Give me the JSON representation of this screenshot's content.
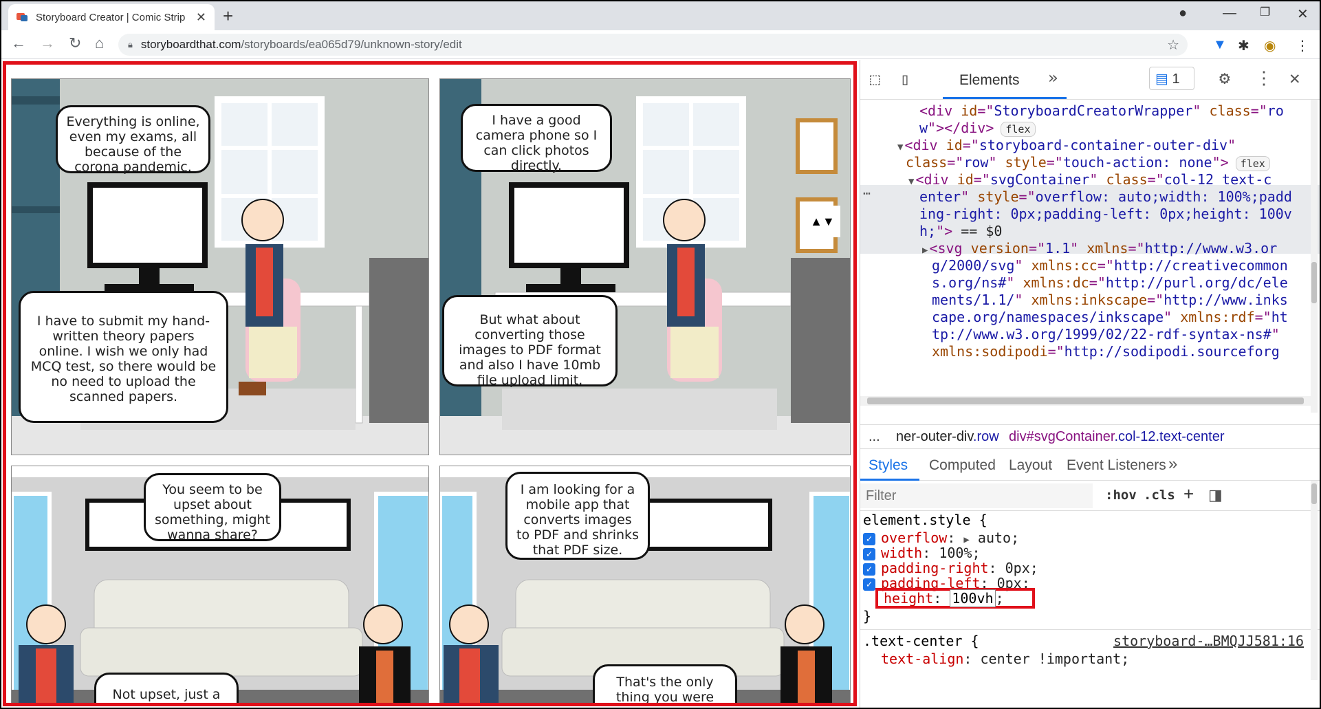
{
  "browser": {
    "tab_title": "Storyboard Creator | Comic Strip",
    "new_tab_label": "+",
    "url_host": "storyboardthat.com",
    "url_path": "/storyboards/ea065d79/unknown-story/edit"
  },
  "comic": {
    "panel1": {
      "bubble_top": "Everything is online, even my exams, all because of the corona pandemic.",
      "bubble_bottom": "I have to submit my hand-written theory papers online. I wish we only had MCQ test, so there would be no need to upload the scanned papers."
    },
    "panel2": {
      "bubble_top": "I have a good camera phone so I can click photos directly.",
      "bubble_bottom": "But what about converting those images to PDF format and also I have 10mb file upload limit.",
      "scroll_arrows": "▲▼"
    },
    "panel3": {
      "bubble_top": "You seem to be upset about something, might wanna share?",
      "bubble_bottom": "Not upset, just a bit"
    },
    "panel4": {
      "bubble_top": "I am looking for a mobile app that converts images to PDF and shrinks that PDF size.",
      "bubble_bottom": "That's the only thing you were worried about"
    }
  },
  "devtools": {
    "panel_tab": "Elements",
    "more_tabs": "»",
    "issues_count": "1",
    "dom_lines": [
      {
        "indent": 86,
        "parts": [
          [
            "tg",
            "<div "
          ],
          [
            "an",
            "id"
          ],
          [
            "tg",
            "=\""
          ],
          [
            "av",
            "StoryboardCreatorWrapper"
          ],
          [
            "tg",
            "\" "
          ],
          [
            "an",
            "class"
          ],
          [
            "tg",
            "=\""
          ],
          [
            "av",
            "ro"
          ]
        ]
      },
      {
        "indent": 86,
        "parts": [
          [
            "av",
            "w"
          ],
          [
            "tg",
            "\"></div>"
          ]
        ],
        "pill": "flex"
      },
      {
        "indent": 70,
        "arrow": "▼",
        "parts": [
          [
            "tg",
            "<div "
          ],
          [
            "an",
            "id"
          ],
          [
            "tg",
            "=\""
          ],
          [
            "av",
            "storyboard-container-outer-div"
          ],
          [
            "tg",
            "\""
          ]
        ]
      },
      {
        "indent": 66,
        "parts": [
          [
            "an",
            "class"
          ],
          [
            "tg",
            "=\""
          ],
          [
            "av",
            "row"
          ],
          [
            "tg",
            "\" "
          ],
          [
            "an",
            "style"
          ],
          [
            "tg",
            "=\""
          ],
          [
            "av",
            "touch-action: none"
          ],
          [
            "tg",
            "\">"
          ]
        ],
        "pill": "flex"
      },
      {
        "indent": 86,
        "arrow": "▼",
        "parts": [
          [
            "tg",
            "<div "
          ],
          [
            "an",
            "id"
          ],
          [
            "tg",
            "=\""
          ],
          [
            "av",
            "svgContainer"
          ],
          [
            "tg",
            "\" "
          ],
          [
            "an",
            "class"
          ],
          [
            "tg",
            "=\""
          ],
          [
            "av",
            "col-12 text-c"
          ]
        ]
      },
      {
        "indent": 86,
        "parts": [
          [
            "av",
            "enter"
          ],
          [
            "tg",
            "\" "
          ],
          [
            "an",
            "style"
          ],
          [
            "tg",
            "=\""
          ],
          [
            "av",
            "overflow: auto;width: 100%;padd"
          ]
        ]
      },
      {
        "indent": 86,
        "parts": [
          [
            "av",
            "ing-right: 0px;padding-left: 0px;height: 100v"
          ]
        ]
      },
      {
        "indent": 86,
        "parts": [
          [
            "av",
            "h;"
          ],
          [
            "tg",
            "\">"
          ],
          [
            "tx",
            " == "
          ],
          [
            "tx",
            "$0"
          ]
        ]
      },
      {
        "indent": 106,
        "arrow": "▶",
        "parts": [
          [
            "tg",
            "<svg "
          ],
          [
            "an",
            "version"
          ],
          [
            "tg",
            "=\""
          ],
          [
            "av",
            "1.1"
          ],
          [
            "tg",
            "\" "
          ],
          [
            "an",
            "xmlns"
          ],
          [
            "tg",
            "=\""
          ],
          [
            "av",
            "http://www.w3.or"
          ]
        ]
      },
      {
        "indent": 104,
        "parts": [
          [
            "av",
            "g/2000/svg"
          ],
          [
            "tg",
            "\" "
          ],
          [
            "an",
            "xmlns:cc"
          ],
          [
            "tg",
            "=\""
          ],
          [
            "av",
            "http://creativecommon"
          ]
        ]
      },
      {
        "indent": 104,
        "parts": [
          [
            "av",
            "s.org/ns#"
          ],
          [
            "tg",
            "\" "
          ],
          [
            "an",
            "xmlns:dc"
          ],
          [
            "tg",
            "=\""
          ],
          [
            "av",
            "http://purl.org/dc/ele"
          ]
        ]
      },
      {
        "indent": 104,
        "parts": [
          [
            "av",
            "ments/1.1/"
          ],
          [
            "tg",
            "\" "
          ],
          [
            "an",
            "xmlns:inkscape"
          ],
          [
            "tg",
            "=\""
          ],
          [
            "av",
            "http://www.inks"
          ]
        ]
      },
      {
        "indent": 104,
        "parts": [
          [
            "av",
            "cape.org/namespaces/inkscape"
          ],
          [
            "tg",
            "\" "
          ],
          [
            "an",
            "xmlns:rdf"
          ],
          [
            "tg",
            "=\""
          ],
          [
            "av",
            "ht"
          ]
        ]
      },
      {
        "indent": 104,
        "parts": [
          [
            "av",
            "tp://www.w3.org/1999/02/22-rdf-syntax-ns#"
          ],
          [
            "tg",
            "\""
          ]
        ]
      },
      {
        "indent": 104,
        "parts": [
          [
            "an",
            "xmlns:sodipodi"
          ],
          [
            "tg",
            "=\""
          ],
          [
            "av",
            "http://sodipodi.sourceforg"
          ]
        ]
      }
    ],
    "breadcrumbs": {
      "ellipsis": "...",
      "crumb1_a": "ner-outer-div",
      "crumb1_b": ".row",
      "crumb2_a": "div#svgContainer",
      "crumb2_b": ".col-12.text-center"
    },
    "subtabs": [
      "Styles",
      "Computed",
      "Layout",
      "Event Listeners"
    ],
    "subtabs_more": "»",
    "filter_placeholder": "Filter",
    "hov": ":hov",
    "cls": ".cls",
    "plus": "+",
    "element_style_selector": "element.style {",
    "props": [
      {
        "name": "overflow",
        "sep": ":",
        "arrow": "▶",
        "value": "auto;"
      },
      {
        "name": "width",
        "sep": ":",
        "value": "100%;"
      },
      {
        "name": "padding-right",
        "sep": ":",
        "value": "0px;"
      },
      {
        "name": "padding-left",
        "sep": ":",
        "value": "0px;"
      }
    ],
    "edited_prop": {
      "name": "height",
      "value": "100vh",
      "tail": ";"
    },
    "close_brace": "}",
    "rule2_selector": ".text-center {",
    "rule2_source": "storyboard-…BMQJJ581:16",
    "rule2_prop": "text-align",
    "rule2_value": "center !important;"
  },
  "colors": {
    "highlight_red": "#e0101a",
    "devtools_blue": "#1a73e8"
  }
}
